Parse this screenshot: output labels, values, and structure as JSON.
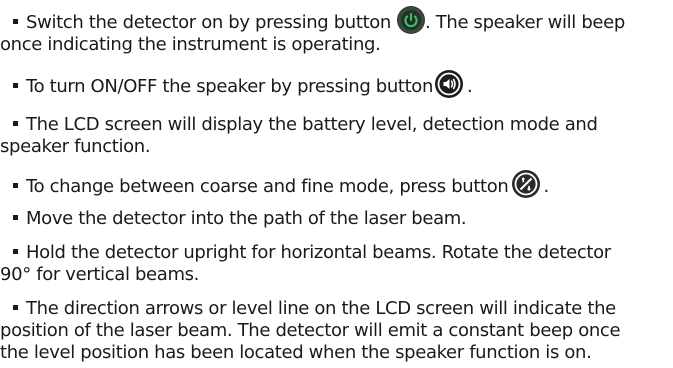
{
  "instructions": [
    {
      "lines": [
        "Switch the detector on by pressing button",
        "once indicating the instrument is operating."
      ],
      "after_icon": ". The speaker will beep",
      "icon": "power-button-icon"
    },
    {
      "lines": [
        "To turn ON/OFF the speaker by pressing button"
      ],
      "after_icon": ".",
      "icon": "speaker-button-icon"
    },
    {
      "lines": [
        "The LCD screen will display the battery level, detection mode and",
        "speaker function."
      ]
    },
    {
      "lines": [
        "To change between coarse and fine mode, press button"
      ],
      "after_icon": ".",
      "icon": "mode-toggle-button-icon"
    },
    {
      "lines": [
        "Move the detector into the path of the laser beam."
      ]
    },
    {
      "lines": [
        "Hold the detector upright for horizontal beams. Rotate the detector",
        "90° for vertical beams."
      ]
    },
    {
      "lines": [
        "The direction arrows or level line on the LCD screen will indicate the",
        "position of the laser beam. The detector will emit a constant beep once",
        "the level position has been located when the speaker function is on."
      ]
    }
  ],
  "colors": {
    "text": "#1a1a1a",
    "power_button_bg": "#2f3a31",
    "power_button_glyph": "#38c46a",
    "speaker_button_bg": "#1c1c1c",
    "mode_button_bg": "#2a2a2a"
  }
}
